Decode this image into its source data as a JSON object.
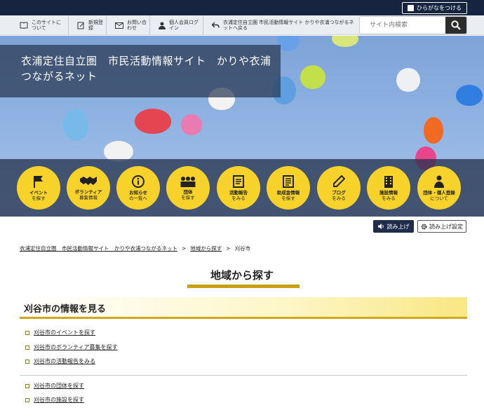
{
  "furigana_button": "ひらがなをつける",
  "nav": {
    "about": "このサイトについて",
    "register": "新規登録",
    "contact": "お問い合わせ",
    "login": "個人会員ログイン",
    "back": "衣浦定住自立圏 市民活動情報サイト かりや衣浦つながるネットへ戻る"
  },
  "search": {
    "placeholder": "サイト内検索"
  },
  "site_title": "衣浦定住自立圏　市民活動情報サイト　かりや衣浦つながるネット",
  "menu": [
    {
      "l1": "イベント",
      "l2": "を探す",
      "icon": "flag-icon"
    },
    {
      "l1": "ボランティア",
      "l2": "募集情報",
      "icon": "handshake-icon"
    },
    {
      "l1": "お知らせ",
      "l2": "の一覧へ",
      "icon": "info-icon"
    },
    {
      "l1": "団体",
      "l2": "を探す",
      "icon": "group-icon"
    },
    {
      "l1": "活動報告",
      "l2": "をみる",
      "icon": "report-icon"
    },
    {
      "l1": "助成金情報",
      "l2": "を探す",
      "icon": "grant-icon"
    },
    {
      "l1": "ブログ",
      "l2": "をみる",
      "icon": "pencil-icon"
    },
    {
      "l1": "施設情報",
      "l2": "をみる",
      "icon": "building-icon"
    },
    {
      "l1": "団体・個人登録",
      "l2": "について",
      "icon": "person-icon"
    }
  ],
  "read_aloud": "読み上げ",
  "read_settings": "読み上げ設定",
  "breadcrumb": {
    "home": "衣浦定住自立圏　市民活動情報サイト　かりや衣浦つながるネット",
    "region": "地域から探す",
    "current": "刈谷市"
  },
  "page_title": "地域から探す",
  "section_title": "刈谷市の情報を見る",
  "links_group1": [
    "刈谷市のイベントを探す",
    "刈谷市のボランティア募集を探す",
    "刈谷市の活動報告をみる"
  ],
  "links_group2": [
    "刈谷市の団体を探す",
    "刈谷市の施設を探す"
  ],
  "colors": {
    "navy": "#16243f",
    "yellow": "#f6d22b",
    "gold": "#c8a017"
  }
}
